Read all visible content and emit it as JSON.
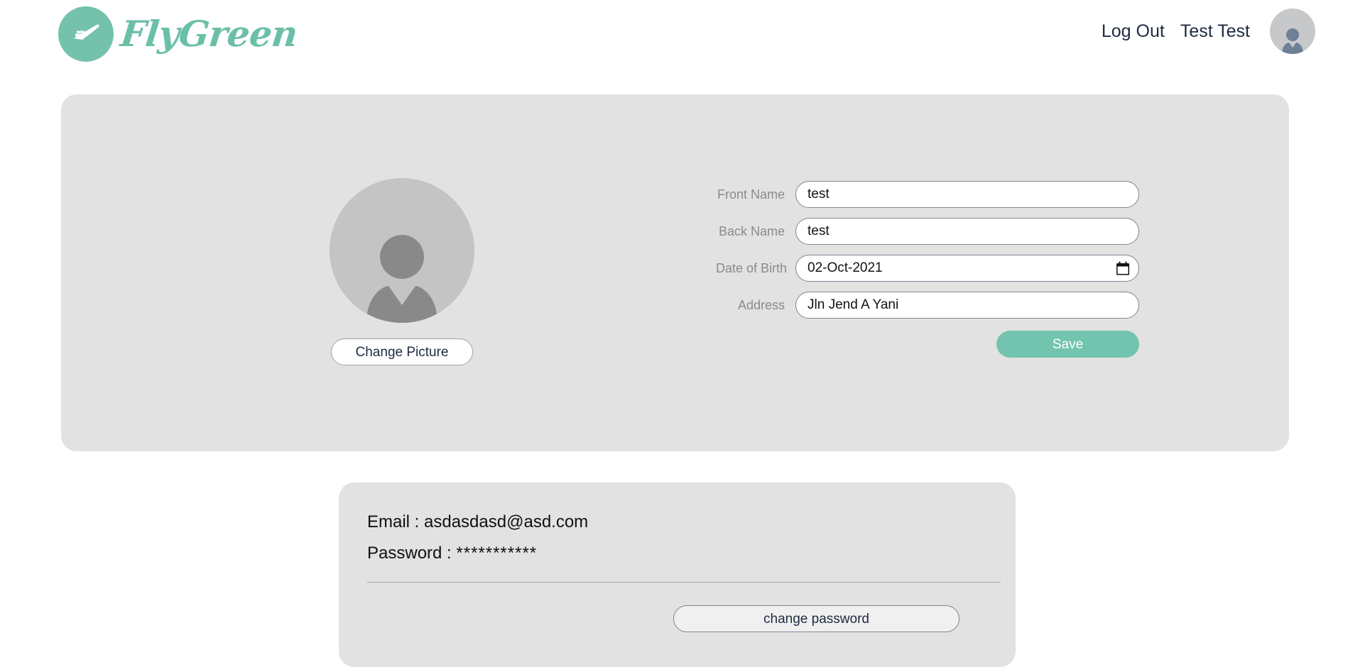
{
  "header": {
    "brand_name": "FlyGreen",
    "brand_icon": "airplane-icon",
    "brand_color": "#6bbfa8",
    "logout_label": "Log Out",
    "user_name": "Test Test",
    "avatar_icon": "user-avatar-icon"
  },
  "profile": {
    "avatar_icon": "user-placeholder-icon",
    "change_picture_label": "Change Picture",
    "fields": [
      {
        "label": "Front Name",
        "value": "test",
        "name": "front-name"
      },
      {
        "label": "Back Name",
        "value": "test",
        "name": "back-name"
      },
      {
        "label": "Date of Birth",
        "value": "02-Oct-2021",
        "name": "date-of-birth"
      },
      {
        "label": "Address",
        "value": "Jln Jend A Yani",
        "name": "address"
      }
    ],
    "calendar_icon": "calendar-icon",
    "save_label": "Save",
    "save_color": "#72c4ae"
  },
  "credentials": {
    "email_line": "Email : asdasdasd@asd.com",
    "password_label": "Password : ",
    "password_mask": "***********",
    "change_password_label": "change password"
  }
}
